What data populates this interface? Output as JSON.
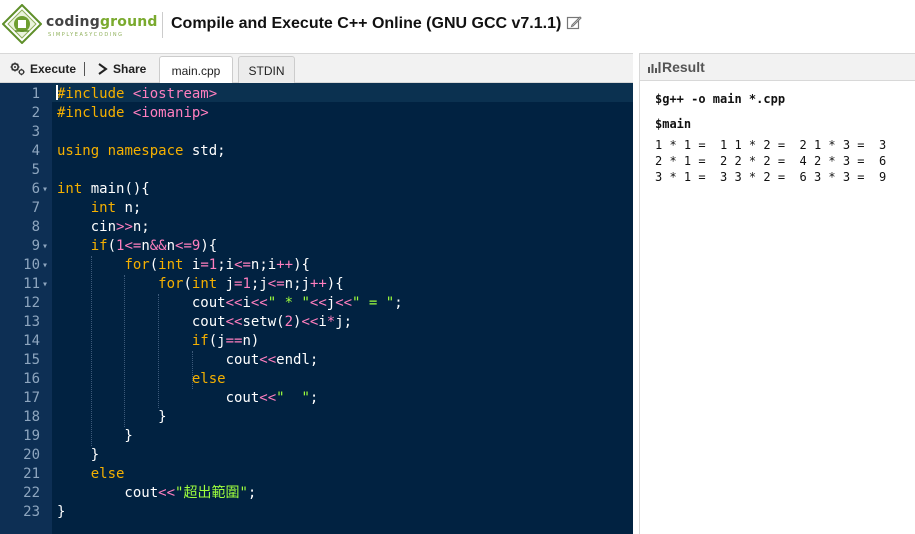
{
  "header": {
    "logo_main_1": "coding",
    "logo_main_2": "ground",
    "logo_sub": "SIMPLYEASYCODING",
    "title": "Compile and Execute C++ Online (GNU GCC v7.1.1)"
  },
  "toolbar": {
    "execute_label": "Execute",
    "share_label": "Share",
    "tabs": [
      {
        "label": "main.cpp",
        "active": true
      },
      {
        "label": "STDIN",
        "active": false
      }
    ]
  },
  "editor": {
    "line_numbers": [
      "1",
      "2",
      "3",
      "4",
      "5",
      "6",
      "7",
      "8",
      "9",
      "10",
      "11",
      "12",
      "13",
      "14",
      "15",
      "16",
      "17",
      "18",
      "19",
      "20",
      "21",
      "22",
      "23"
    ],
    "folded_lines": [
      6,
      9,
      10,
      11
    ],
    "lines": [
      "#include <iostream>",
      "#include <iomanip>",
      "",
      "using namespace std;",
      "",
      "int main(){",
      "    int n;",
      "    cin>>n;",
      "    if(1<=n&&n<=9){",
      "        for(int i=1;i<=n;i++){",
      "            for(int j=1;j<=n;j++){",
      "                cout<<i<<\" * \"<<j<<\" = \";",
      "                cout<<setw(2)<<i*j;",
      "                if(j==n)",
      "                    cout<<endl;",
      "                else",
      "                    cout<<\"  \";",
      "            }",
      "        }",
      "    }",
      "    else",
      "        cout<<\"超出範圍\";",
      "}"
    ]
  },
  "result": {
    "title": "Result",
    "compile_cmd": "$g++ -o main *.cpp",
    "run_cmd": "$main",
    "output_lines": [
      "1 * 1 =  1 1 * 2 =  2 1 * 3 =  3",
      "2 * 1 =  2 2 * 2 =  4 2 * 3 =  6",
      "3 * 1 =  3 3 * 2 =  6 3 * 3 =  9"
    ]
  },
  "colors": {
    "editor_bg": "#012241",
    "gutter_bg": "#0d2f54",
    "keyword": "#f5b000",
    "string": "#9eff3d",
    "number_operator": "#ff7fbf",
    "logo_green": "#7aaa2e"
  },
  "icons": {
    "execute": "gears-icon",
    "share": "chevron-right-icon",
    "edit": "edit-icon",
    "result": "bar-chart-icon"
  }
}
